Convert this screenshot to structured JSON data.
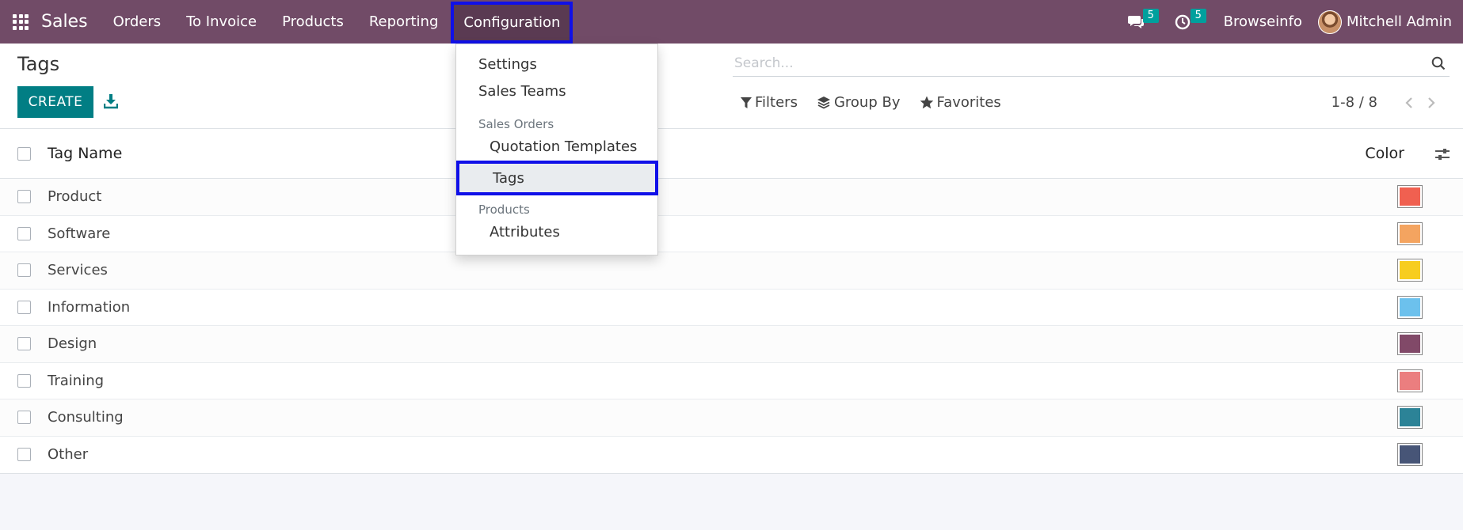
{
  "navbar": {
    "brand": "Sales",
    "menu": [
      "Orders",
      "To Invoice",
      "Products",
      "Reporting",
      "Configuration"
    ],
    "messages_count": "5",
    "activities_count": "5",
    "company": "Browseinfo",
    "user": "Mitchell Admin"
  },
  "control_panel": {
    "title": "Tags",
    "create_label": "CREATE",
    "search_placeholder": "Search...",
    "filters_label": "Filters",
    "groupby_label": "Group By",
    "favorites_label": "Favorites",
    "pager": "1-8 / 8"
  },
  "list": {
    "columns": [
      "Tag Name",
      "Color"
    ],
    "rows": [
      {
        "name": "Product",
        "color": "#f06050"
      },
      {
        "name": "Software",
        "color": "#f4a460"
      },
      {
        "name": "Services",
        "color": "#f7cd1f"
      },
      {
        "name": "Information",
        "color": "#6cc1ed"
      },
      {
        "name": "Design",
        "color": "#814968"
      },
      {
        "name": "Training",
        "color": "#eb7e7f"
      },
      {
        "name": "Consulting",
        "color": "#2c8397"
      },
      {
        "name": "Other",
        "color": "#475577"
      }
    ]
  },
  "dropdown": {
    "settings": "Settings",
    "sales_teams": "Sales Teams",
    "section_sales_orders": "Sales Orders",
    "quotation_templates": "Quotation Templates",
    "tags": "Tags",
    "section_products": "Products",
    "attributes": "Attributes"
  },
  "colors": {
    "navbar": "#714b67",
    "primary": "#017e84",
    "badge": "#00a09d",
    "highlight_border": "#1010e8"
  },
  "icons": [
    "apps-grid-icon",
    "chat-icon",
    "clock-icon",
    "download-icon",
    "search-icon",
    "filter-icon",
    "layers-icon",
    "star-icon",
    "chevron-left-icon",
    "chevron-right-icon",
    "sliders-icon"
  ]
}
